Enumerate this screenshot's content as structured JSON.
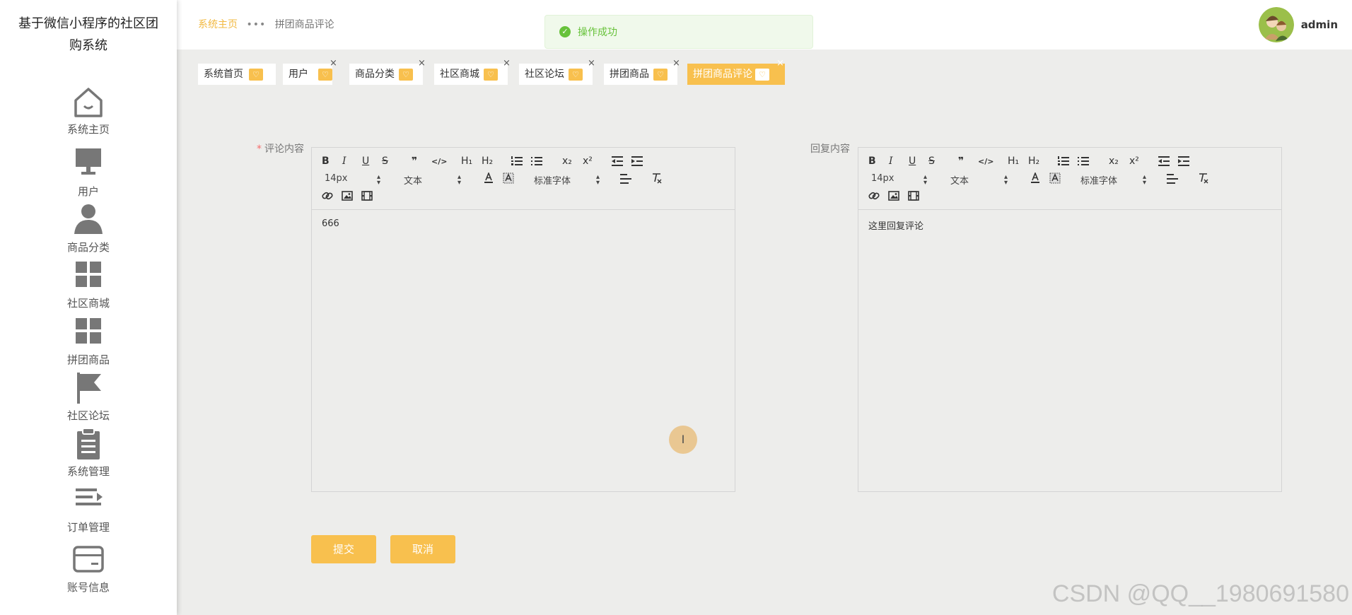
{
  "app": {
    "title": "基于微信小程序的社区团购系统"
  },
  "sidebar": {
    "items": [
      {
        "label": "系统主页",
        "icon": "home-icon"
      },
      {
        "label": "用户",
        "icon": "monitor-icon"
      },
      {
        "label": "商品分类",
        "icon": "user-icon"
      },
      {
        "label": "社区商城",
        "icon": "grid-icon"
      },
      {
        "label": "拼团商品",
        "icon": "grid-icon"
      },
      {
        "label": "社区论坛",
        "icon": "flag-icon"
      },
      {
        "label": "系统管理",
        "icon": "clipboard-icon"
      },
      {
        "label": "订单管理",
        "icon": "list-icon"
      },
      {
        "label": "账号信息",
        "icon": "card-icon"
      }
    ]
  },
  "header": {
    "breadcrumb": {
      "home": "系统主页",
      "separator": "•••",
      "current": "拼团商品评论"
    },
    "username": "admin"
  },
  "toast": {
    "text": "操作成功"
  },
  "tabs": [
    {
      "label": "系统首页",
      "active": false,
      "closable": false
    },
    {
      "label": "用户",
      "active": false,
      "closable": true
    },
    {
      "label": "商品分类",
      "active": false,
      "closable": true
    },
    {
      "label": "社区商城",
      "active": false,
      "closable": true
    },
    {
      "label": "社区论坛",
      "active": false,
      "closable": true
    },
    {
      "label": "拼团商品",
      "active": false,
      "closable": true
    },
    {
      "label": "拼团商品评论",
      "active": true,
      "closable": true
    }
  ],
  "form": {
    "comment": {
      "label": "评论内容",
      "required_mark": "*",
      "content": "666",
      "font_size": "14px",
      "paragraph": "文本",
      "font_family": "标准字体"
    },
    "reply": {
      "label": "回复内容",
      "content": "这里回复评论",
      "font_size": "14px",
      "paragraph": "文本",
      "font_family": "标准字体"
    },
    "buttons": {
      "submit": "提交",
      "cancel": "取消"
    }
  },
  "toolbar_labels": {
    "bold": "B",
    "italic": "I",
    "underline": "U",
    "strike": "S",
    "quote": "❞",
    "code": "</>",
    "h1": "H₁",
    "h2": "H₂",
    "sub": "x₂",
    "sup": "x²"
  },
  "cursor": {
    "glyph": "I"
  },
  "watermark": "CSDN @QQ__1980691580",
  "colors": {
    "accent": "#f8c04e",
    "success": "#67c23a",
    "background": "#ededeb"
  }
}
